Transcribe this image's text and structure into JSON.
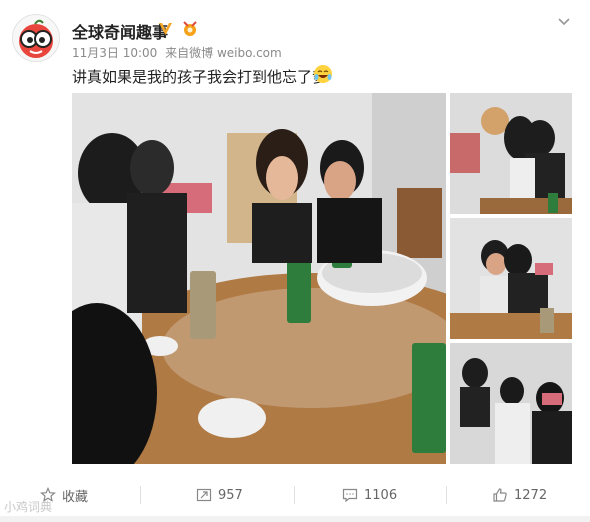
{
  "header": {
    "account_name": "全球奇闻趣事",
    "date": "11月3日 10:00",
    "source_prefix": "来自",
    "source": "微博 weibo.com",
    "verified_icon": "verified-v-icon",
    "medal_icon": "member-medal-icon",
    "menu_icon": "chevron-down-icon"
  },
  "post": {
    "text": "讲真如果是我的孩子我会打到他忘了爹",
    "emoji": "laughing-face-icon"
  },
  "images": {
    "main_alt": "group-photo-at-dinner-table",
    "r1_alt": "couple-kiss-photo",
    "r2_alt": "couple-hug-photo",
    "r3_alt": "onlookers-photo"
  },
  "actions": {
    "favorite_label": "收藏",
    "repost_count": "957",
    "comment_count": "1106",
    "like_count": "1272"
  },
  "watermark": "小鸡词典",
  "colors": {
    "verified": "#f5a623",
    "name": "#222222",
    "meta": "#8a8a8a"
  }
}
